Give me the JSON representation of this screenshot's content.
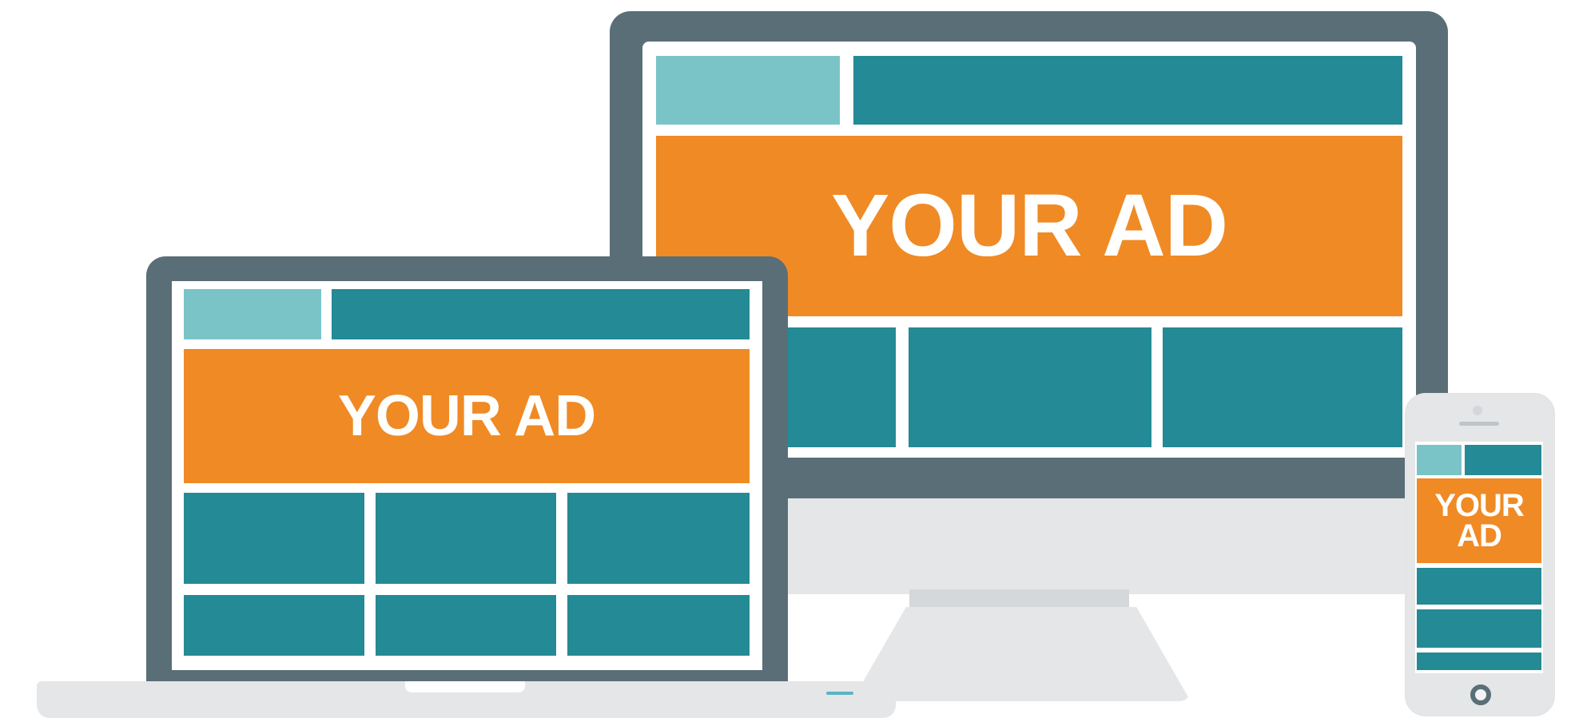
{
  "ad_text": "YOUR AD",
  "phone_ad_lines": [
    "YOUR",
    "AD"
  ],
  "colors": {
    "frame_dark": "#5a6e78",
    "device_body_light": "#e4e6e8",
    "header_light_teal": "#7ac4c7",
    "content_teal": "#248a95",
    "ad_orange": "#f08a24",
    "screen_white": "#ffffff"
  },
  "devices": {
    "desktop_monitor": {
      "icon": "desktop-monitor-icon"
    },
    "laptop": {
      "icon": "laptop-icon"
    },
    "phone": {
      "icon": "smartphone-icon"
    }
  }
}
